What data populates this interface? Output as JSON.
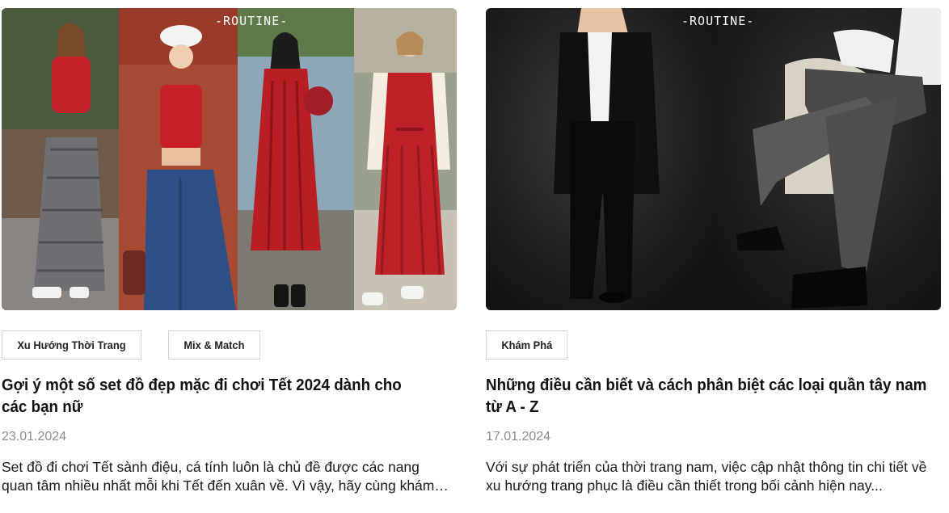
{
  "articles": [
    {
      "brand_logo": "-ROUTINE-",
      "tags": [
        "Xu Hướng Thời Trang",
        "Mix & Match"
      ],
      "title": "Gợi ý một số set đồ đẹp mặc đi chơi Tết 2024 dành cho các bạn nữ",
      "date": "23.01.2024",
      "excerpt": "Set đồ đi chơi Tết sành điệu, cá tính luôn là chủ đề được các nang quan tâm nhiều nhất mỗi khi Tết đến xuân về.  Vì vậy, hãy cùng khám phá..."
    },
    {
      "brand_logo": "-ROUTINE-",
      "tags": [
        "Khám Phá"
      ],
      "title": "Những điều cần biết và cách phân biệt các loại quần tây nam từ A - Z",
      "date": "17.01.2024",
      "excerpt": "Với sự phát triển của thời trang nam, việc cập nhật thông tin chi tiết về xu hướng trang phục là điều cần thiết trong bối cảnh hiện nay..."
    }
  ],
  "colors": {
    "dress_red": "#b81e24",
    "studio_dark": "#262626",
    "meta_gray": "#8c8c8c",
    "tag_border": "#cfcfcf"
  }
}
